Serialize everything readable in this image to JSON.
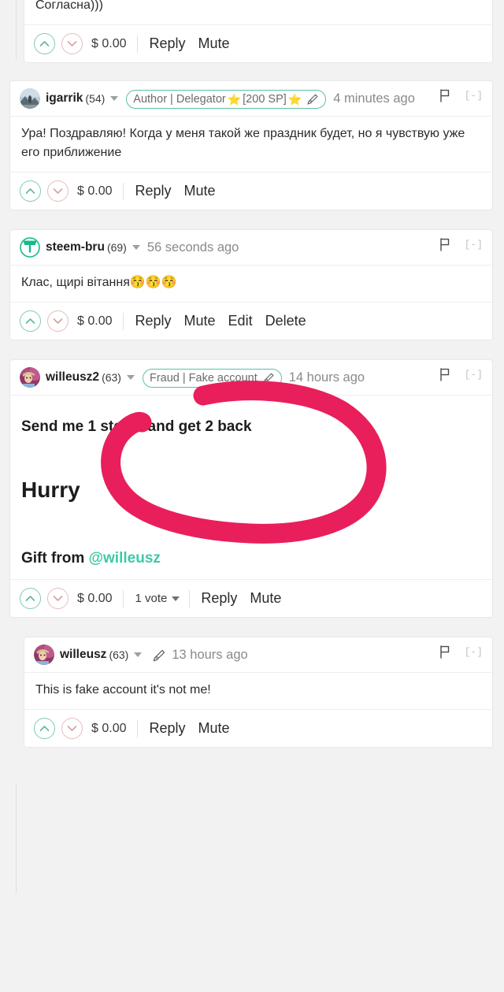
{
  "page": {
    "background_color": "#f2f2f2",
    "card_color": "#ffffff",
    "accent_color": "#3ec9a7",
    "annotation_color": "#e8२0५b"
  },
  "annotation": {
    "name": "pink-circle-highlight",
    "color": "#e81f5b",
    "shape": "hand-drawn ellipse around the Fraud | Fake account badge"
  },
  "comments": [
    {
      "id": "comment-partial-top",
      "level": 1,
      "header_visible": false,
      "body": "Согласна)))",
      "footer": {
        "payout": "$ 0.00",
        "upvote_icon": "chevron-up-icon",
        "downvote_icon": "chevron-down-icon",
        "actions": [
          "Reply",
          "Mute"
        ]
      }
    },
    {
      "id": "comment-igarrik",
      "level": 0,
      "header_visible": true,
      "author": "igarrik",
      "reputation": "(54)",
      "badge": {
        "text_before": "Author | Delegator",
        "star": "⭐",
        "sp": "[200 SP]",
        "star2": "⭐",
        "pen_icon": "pencil-icon"
      },
      "timestamp": "4 minutes ago",
      "flag_icon": "flag-icon",
      "collapse_label": "[-]",
      "body": "Ура! Поздравляю! Когда у меня такой же праздник будет, но я чувствую уже его приближение",
      "footer": {
        "payout": "$ 0.00",
        "upvote_icon": "chevron-up-icon",
        "downvote_icon": "chevron-down-icon",
        "actions": [
          "Reply",
          "Mute"
        ]
      }
    },
    {
      "id": "comment-steem-bru",
      "level": 0,
      "header_visible": true,
      "author": "steem-bru",
      "reputation": "(69)",
      "badge": null,
      "timestamp": "56 seconds ago",
      "flag_icon": "flag-icon",
      "collapse_label": "[-]",
      "body": "Клас, щирі вітання😚😚😚",
      "footer": {
        "payout": "$ 0.00",
        "upvote_icon": "chevron-up-icon",
        "downvote_icon": "chevron-down-icon",
        "actions": [
          "Reply",
          "Mute",
          "Edit",
          "Delete"
        ]
      }
    },
    {
      "id": "comment-willeusz2",
      "level": 0,
      "header_visible": true,
      "author": "willeusz2",
      "reputation": "(63)",
      "badge": {
        "text_before": "Fraud | Fake account",
        "pen_icon": "pencil-icon"
      },
      "timestamp": "14 hours ago",
      "flag_icon": "flag-icon",
      "collapse_label": "[-]",
      "body_heading1": "Send me 1 steem and get 2 back",
      "body_heading2": "Hurry",
      "body_gift_prefix": "Gift from",
      "body_gift_mention": "@willeusz",
      "footer": {
        "payout": "$ 0.00",
        "votes": "1 vote",
        "upvote_icon": "chevron-up-icon",
        "downvote_icon": "chevron-down-icon",
        "actions": [
          "Reply",
          "Mute"
        ]
      }
    },
    {
      "id": "comment-willeusz",
      "level": 1,
      "header_visible": true,
      "author": "willeusz",
      "reputation": "(63)",
      "badge": null,
      "pen_icon": "pencil-icon",
      "timestamp": "13 hours ago",
      "flag_icon": "flag-icon",
      "collapse_label": "[-]",
      "body": "This is fake account it's not me!",
      "footer": {
        "payout": "$ 0.00",
        "upvote_icon": "chevron-up-icon",
        "downvote_icon": "chevron-down-icon",
        "actions": [
          "Reply",
          "Mute"
        ]
      }
    }
  ]
}
